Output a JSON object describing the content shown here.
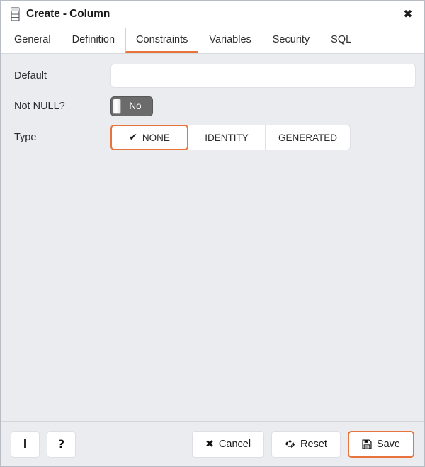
{
  "window": {
    "title": "Create - Column",
    "icon": "column-icon",
    "close_label": "✖"
  },
  "tabs": [
    {
      "label": "General",
      "active": false
    },
    {
      "label": "Definition",
      "active": false
    },
    {
      "label": "Constraints",
      "active": true
    },
    {
      "label": "Variables",
      "active": false
    },
    {
      "label": "Security",
      "active": false
    },
    {
      "label": "SQL",
      "active": false
    }
  ],
  "form": {
    "default": {
      "label": "Default",
      "value": "",
      "placeholder": ""
    },
    "not_null": {
      "label": "Not NULL?",
      "value": "No"
    },
    "type": {
      "label": "Type",
      "selected": "NONE",
      "options": [
        {
          "label": "NONE",
          "selected": true,
          "check": "✔"
        },
        {
          "label": "IDENTITY",
          "selected": false
        },
        {
          "label": "GENERATED",
          "selected": false
        }
      ]
    }
  },
  "footer": {
    "info_label": "i",
    "help_label": "?",
    "cancel_label": "Cancel",
    "cancel_glyph": "✖",
    "reset_label": "Reset",
    "reset_glyph": "♻",
    "save_label": "Save",
    "save_glyph": "ὋE"
  },
  "colors": {
    "accent": "#e9733d",
    "accent_light": "#f6c6ab",
    "body_bg": "#eaecf0",
    "toggle_off_bg": "#6b6b6b"
  }
}
